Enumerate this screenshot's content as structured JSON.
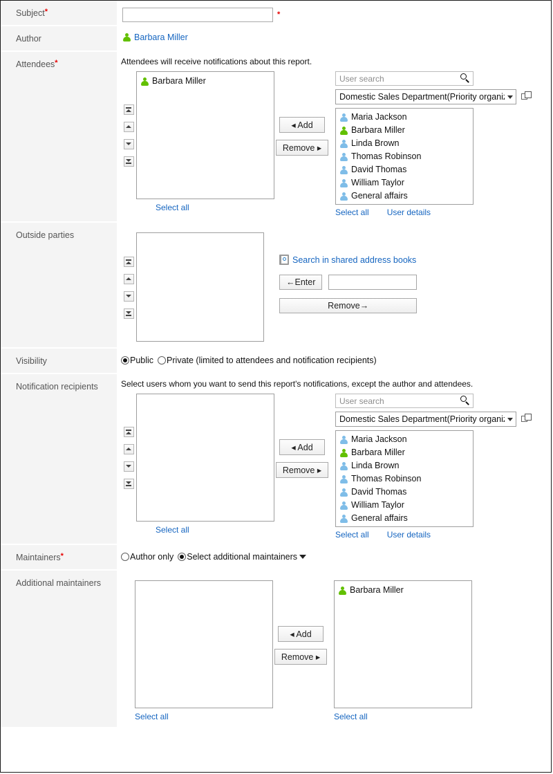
{
  "form": {
    "rows": {
      "subject": {
        "label": "Subject",
        "required": true,
        "input_value": "",
        "input_placeholder": ""
      },
      "author": {
        "label": "Author",
        "user": "Barbara Miller"
      },
      "attendees": {
        "label": "Attendees",
        "required": true,
        "hint": "Attendees will receive notifications about this report.",
        "selected": [
          {
            "name": "Barbara Miller",
            "icon": "user-icon-green"
          }
        ],
        "select_all_left": "Select all",
        "add_button": "Add",
        "remove_button": "Remove",
        "search_placeholder": "User search",
        "search_value": "",
        "organization": "Domestic Sales Department(Priority organization)",
        "candidates": [
          {
            "name": "Maria Jackson",
            "icon": "user-icon-blue"
          },
          {
            "name": "Barbara Miller",
            "icon": "user-icon-green"
          },
          {
            "name": "Linda Brown",
            "icon": "user-icon-blue"
          },
          {
            "name": "Thomas Robinson",
            "icon": "user-icon-blue"
          },
          {
            "name": "David Thomas",
            "icon": "user-icon-blue"
          },
          {
            "name": "William Taylor",
            "icon": "user-icon-blue"
          },
          {
            "name": "General affairs",
            "icon": "user-icon-blue"
          }
        ],
        "select_all_right": "Select all",
        "user_details": "User details"
      },
      "outside_parties": {
        "label": "Outside parties",
        "selected": [],
        "address_book_link": "Search in shared address books",
        "enter_button": "←Enter",
        "enter_value": "",
        "remove_button": "Remove→"
      },
      "visibility": {
        "label": "Visibility",
        "options": [
          {
            "label": "Public",
            "selected": true
          },
          {
            "label": "Private (limited to attendees and notification recipients)",
            "selected": false
          }
        ]
      },
      "notification_recipients": {
        "label": "Notification recipients",
        "hint": "Select users whom you want to send this report's notifications, except the author and attendees.",
        "selected": [],
        "select_all_left": "Select all",
        "add_button": "Add",
        "remove_button": "Remove",
        "search_placeholder": "User search",
        "search_value": "",
        "organization": "Domestic Sales Department(Priority organization)",
        "candidates": [
          {
            "name": "Maria Jackson",
            "icon": "user-icon-blue"
          },
          {
            "name": "Barbara Miller",
            "icon": "user-icon-green"
          },
          {
            "name": "Linda Brown",
            "icon": "user-icon-blue"
          },
          {
            "name": "Thomas Robinson",
            "icon": "user-icon-blue"
          },
          {
            "name": "David Thomas",
            "icon": "user-icon-blue"
          },
          {
            "name": "William Taylor",
            "icon": "user-icon-blue"
          },
          {
            "name": "General affairs",
            "icon": "user-icon-blue"
          }
        ],
        "select_all_right": "Select all",
        "user_details": "User details"
      },
      "maintainers": {
        "label": "Maintainers",
        "required": true,
        "options": [
          {
            "label": "Author only",
            "selected": false
          },
          {
            "label": "Select additional maintainers",
            "selected": true
          }
        ]
      },
      "additional_maintainers": {
        "label": "Additional maintainers",
        "candidates": [],
        "select_all_left": "Select all",
        "add_button": "Add",
        "remove_button": "Remove",
        "selected": [
          {
            "name": "Barbara Miller",
            "icon": "user-icon-green"
          }
        ],
        "select_all_right": "Select all"
      }
    },
    "order_buttons": {
      "move_top": "move-to-top",
      "move_up": "move-up",
      "move_down": "move-down",
      "move_bottom": "move-to-bottom"
    },
    "colors": {
      "link": "#1565c0",
      "required": "#e60000",
      "label_bg": "#f4f4f4",
      "user_green": "#62c000",
      "user_blue": "#7fbde8"
    }
  }
}
